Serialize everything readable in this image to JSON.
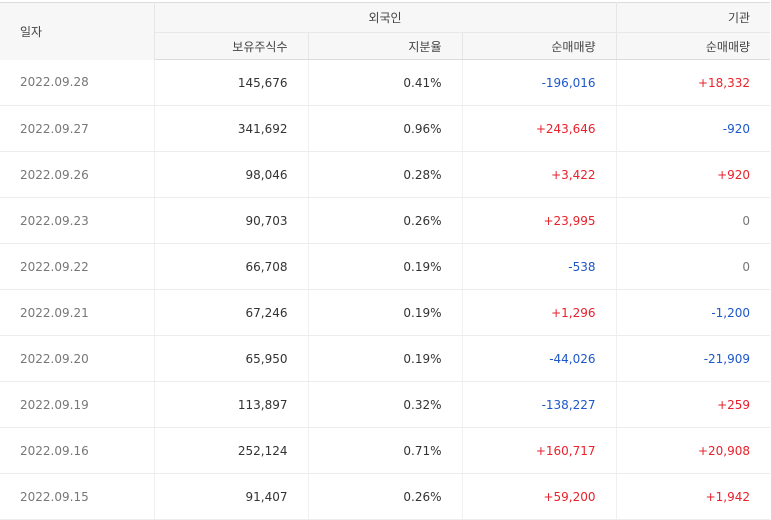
{
  "header": {
    "date_label": "일자",
    "foreign_group": "외국인",
    "institution_group": "기관",
    "holdings_label": "보유주식수",
    "ratio_label": "지분율",
    "foreign_net_label": "순매매량",
    "institution_net_label": "순매매량"
  },
  "rows": [
    {
      "date": "2022.09.28",
      "holdings": "145,676",
      "ratio": "0.41%",
      "foreign_net": "-196,016",
      "institution_net": "+18,332"
    },
    {
      "date": "2022.09.27",
      "holdings": "341,692",
      "ratio": "0.96%",
      "foreign_net": "+243,646",
      "institution_net": "-920"
    },
    {
      "date": "2022.09.26",
      "holdings": "98,046",
      "ratio": "0.28%",
      "foreign_net": "+3,422",
      "institution_net": "+920"
    },
    {
      "date": "2022.09.23",
      "holdings": "90,703",
      "ratio": "0.26%",
      "foreign_net": "+23,995",
      "institution_net": "0"
    },
    {
      "date": "2022.09.22",
      "holdings": "66,708",
      "ratio": "0.19%",
      "foreign_net": "-538",
      "institution_net": "0"
    },
    {
      "date": "2022.09.21",
      "holdings": "67,246",
      "ratio": "0.19%",
      "foreign_net": "+1,296",
      "institution_net": "-1,200"
    },
    {
      "date": "2022.09.20",
      "holdings": "65,950",
      "ratio": "0.19%",
      "foreign_net": "-44,026",
      "institution_net": "-21,909"
    },
    {
      "date": "2022.09.19",
      "holdings": "113,897",
      "ratio": "0.32%",
      "foreign_net": "-138,227",
      "institution_net": "+259"
    },
    {
      "date": "2022.09.16",
      "holdings": "252,124",
      "ratio": "0.71%",
      "foreign_net": "+160,717",
      "institution_net": "+20,908"
    },
    {
      "date": "2022.09.15",
      "holdings": "91,407",
      "ratio": "0.26%",
      "foreign_net": "+59,200",
      "institution_net": "+1,942"
    }
  ],
  "colors": {
    "positive": "#e8212b",
    "negative": "#1d57c9",
    "neutral": "#777777",
    "header_bg": "#f7f7f7"
  }
}
